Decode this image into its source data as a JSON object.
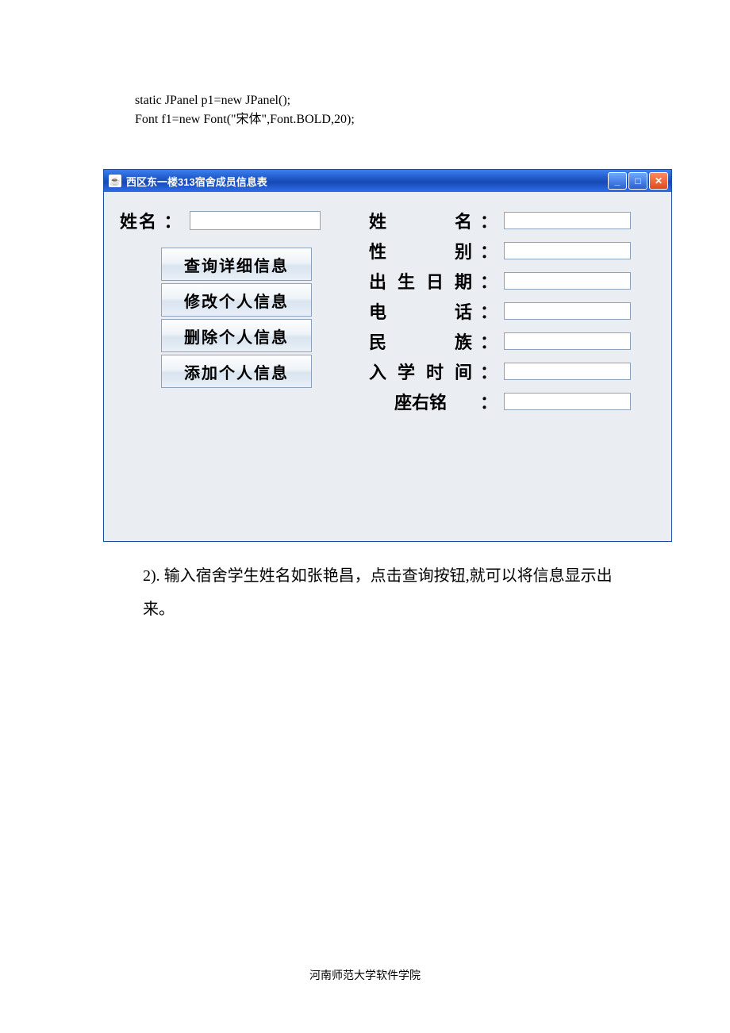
{
  "code": {
    "line1": "static JPanel p1=new JPanel();",
    "line2": "Font f1=new Font(\"宋体\",Font.BOLD,20);"
  },
  "window": {
    "title": "西区东一楼313宿舍成员信息表",
    "icon_label": "☕"
  },
  "left": {
    "name_label": "姓名 ：",
    "search_value": "",
    "buttons": {
      "query": "查询详细信息",
      "modify": "修改个人信息",
      "delete": "删除个人信息",
      "add": "添加个人信息"
    }
  },
  "fields": {
    "name": {
      "label": "姓　　名",
      "value": ""
    },
    "gender": {
      "label": "性　　别",
      "value": ""
    },
    "birth": {
      "label": "出生日期",
      "value": ""
    },
    "phone": {
      "label": "电　　话",
      "value": ""
    },
    "nation": {
      "label": "民　　族",
      "value": ""
    },
    "enroll": {
      "label": "入学时间",
      "value": ""
    },
    "motto": {
      "label": "座右铭",
      "value": ""
    }
  },
  "colon_wide": "：",
  "body_paragraph": "2). 输入宿舍学生姓名如张艳昌，点击查询按钮,就可以将信息显示出来。",
  "footer": "河南师范大学软件学院"
}
